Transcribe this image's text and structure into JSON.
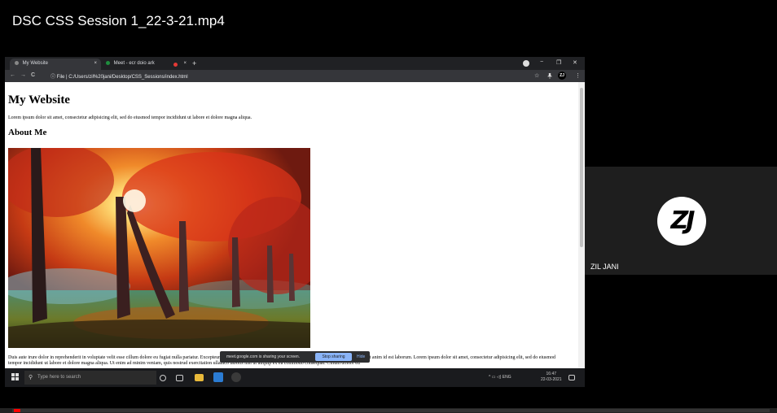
{
  "video": {
    "title": "DSC CSS Session 1_22-3-21.mp4",
    "progress_fraction": 0.01
  },
  "browser": {
    "tabs": [
      {
        "label": "My Website",
        "close": "×",
        "active": true
      },
      {
        "label": "Meet - ecr doio ark",
        "close": "×",
        "active": false
      }
    ],
    "new_tab": "+",
    "window_controls": {
      "minimize": "−",
      "restore": "❐",
      "close": "✕"
    },
    "nav": {
      "back": "←",
      "forward": "→",
      "reload": "C"
    },
    "url_prefix": "ⓘ File |",
    "url": "C:/Users/zil%20jani/Desktop/CSS_Sessions/index.html",
    "star": "☆",
    "profile_initials": "ZJ",
    "menu": "⋮"
  },
  "page": {
    "heading": "My Website",
    "lead": "Lorem ipsum dolor sit amet, consectetur adipisicing elit, sed do eiusmod tempor incididunt ut labore et dolore magna aliqua.",
    "subheading": "About Me",
    "body": "Duis aute irure dolor in reprehenderit in voluptate velit esse cillum dolore eu fugiat nulla pariatur. Excepteur sint occaecat cupidatat non proident, sunt in culpa qui officia deserunt mollit anim id est laborum. Lorem ipsum dolor sit amet, consectetur adipisicing elit, sed do eiusmod tempor incididunt ut labore et dolore magna aliqua. Ut enim ad minim veniam, quis nostrud exercitation ullamco laboris nisi ut aliquip ex ea commodo consequat. Cillum dolore eu"
  },
  "share_bar": {
    "message": "meet.google.com is sharing your screen.",
    "stop_label": "Stop sharing",
    "hide_label": "Hide"
  },
  "taskbar": {
    "search_placeholder": "Type here to search",
    "tray_text": "^ ▭ ◁) ENG",
    "time": "16:47",
    "date": "22-03-2021"
  },
  "participant": {
    "initials": "ZJ",
    "name": "ZIL JANI"
  }
}
